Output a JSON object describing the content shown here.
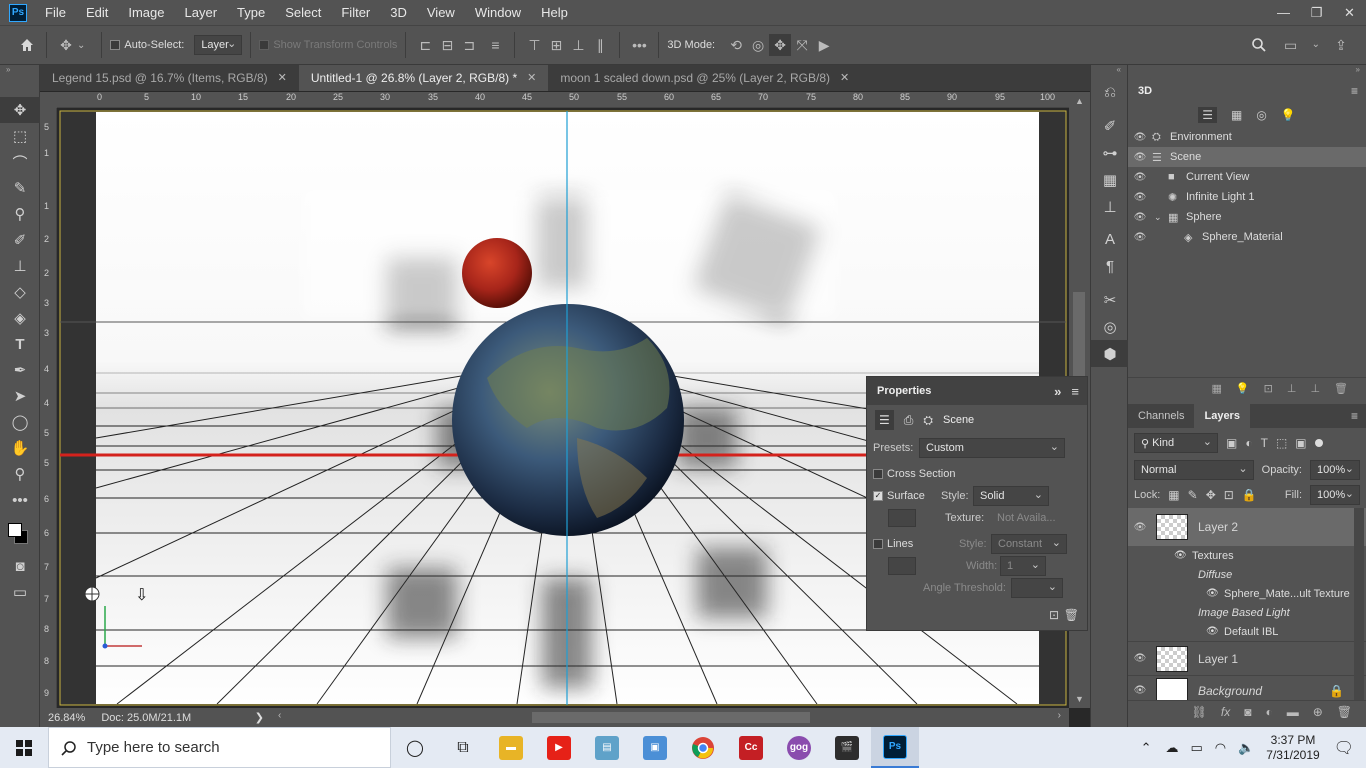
{
  "app": {
    "logo_text": "Ps"
  },
  "menu": [
    "File",
    "Edit",
    "Image",
    "Layer",
    "Type",
    "Select",
    "Filter",
    "3D",
    "View",
    "Window",
    "Help"
  ],
  "window_controls": {
    "minimize": "—",
    "restore": "❐",
    "close": "✕"
  },
  "options": {
    "auto_select_label": "Auto-Select:",
    "auto_select_value": "Layer",
    "show_transform_label": "Show Transform Controls",
    "mode_label": "3D Mode:"
  },
  "tabs": [
    {
      "label": "Legend 15.psd @ 16.7% (Items, RGB/8)",
      "close": "✕"
    },
    {
      "label": "Untitled-1 @ 26.8% (Layer 2, RGB/8) *",
      "close": "✕"
    },
    {
      "label": "moon 1 scaled down.psd @ 25% (Layer 2, RGB/8)",
      "close": "✕"
    }
  ],
  "ruler_h": [
    "0",
    "5",
    "10",
    "15",
    "20",
    "25",
    "30",
    "35",
    "40",
    "45",
    "50",
    "55",
    "60",
    "65",
    "70",
    "75",
    "80",
    "85",
    "90",
    "95",
    "100"
  ],
  "ruler_v": [
    "5",
    "1",
    "1",
    "2",
    "2",
    "3",
    "3",
    "4",
    "4",
    "5",
    "5",
    "6",
    "6",
    "7",
    "7",
    "8",
    "8",
    "9"
  ],
  "status": {
    "zoom": "26.84%",
    "doc": "Doc: 25.0M/21.1M",
    "arrow": "❯"
  },
  "properties": {
    "title": "Properties",
    "scene_label": "Scene",
    "presets_label": "Presets:",
    "presets_value": "Custom",
    "cross_section": "Cross Section",
    "surface": "Surface",
    "style_label": "Style:",
    "surface_style": "Solid",
    "texture_label": "Texture:",
    "texture_value": "Not Availa...",
    "lines": "Lines",
    "lines_style": "Constant",
    "width_label": "Width:",
    "width_value": "1",
    "angle_label": "Angle Threshold:"
  },
  "panel3d": {
    "title": "3D",
    "items": [
      {
        "label": "Environment",
        "indent": 0
      },
      {
        "label": "Scene",
        "indent": 0
      },
      {
        "label": "Current View",
        "indent": 1
      },
      {
        "label": "Infinite Light 1",
        "indent": 1
      },
      {
        "label": "Sphere",
        "indent": 1
      },
      {
        "label": "Sphere_Material",
        "indent": 2
      }
    ]
  },
  "layers_panel": {
    "tabs": [
      "Channels",
      "Layers"
    ],
    "kind_label": "Kind",
    "blend_mode": "Normal",
    "opacity_label": "Opacity:",
    "opacity_value": "100%",
    "lock_label": "Lock:",
    "fill_label": "Fill:",
    "fill_value": "100%",
    "layer2": "Layer 2",
    "textures": "Textures",
    "diffuse": "Diffuse",
    "sphere_texture": "Sphere_Mate...ult Texture",
    "ibl": "Image Based Light",
    "default_ibl": "Default IBL",
    "layer1": "Layer 1",
    "background": "Background",
    "fx": "fx"
  },
  "taskbar": {
    "search_placeholder": "Type here to search",
    "time": "3:37 PM",
    "date": "7/31/2019"
  }
}
